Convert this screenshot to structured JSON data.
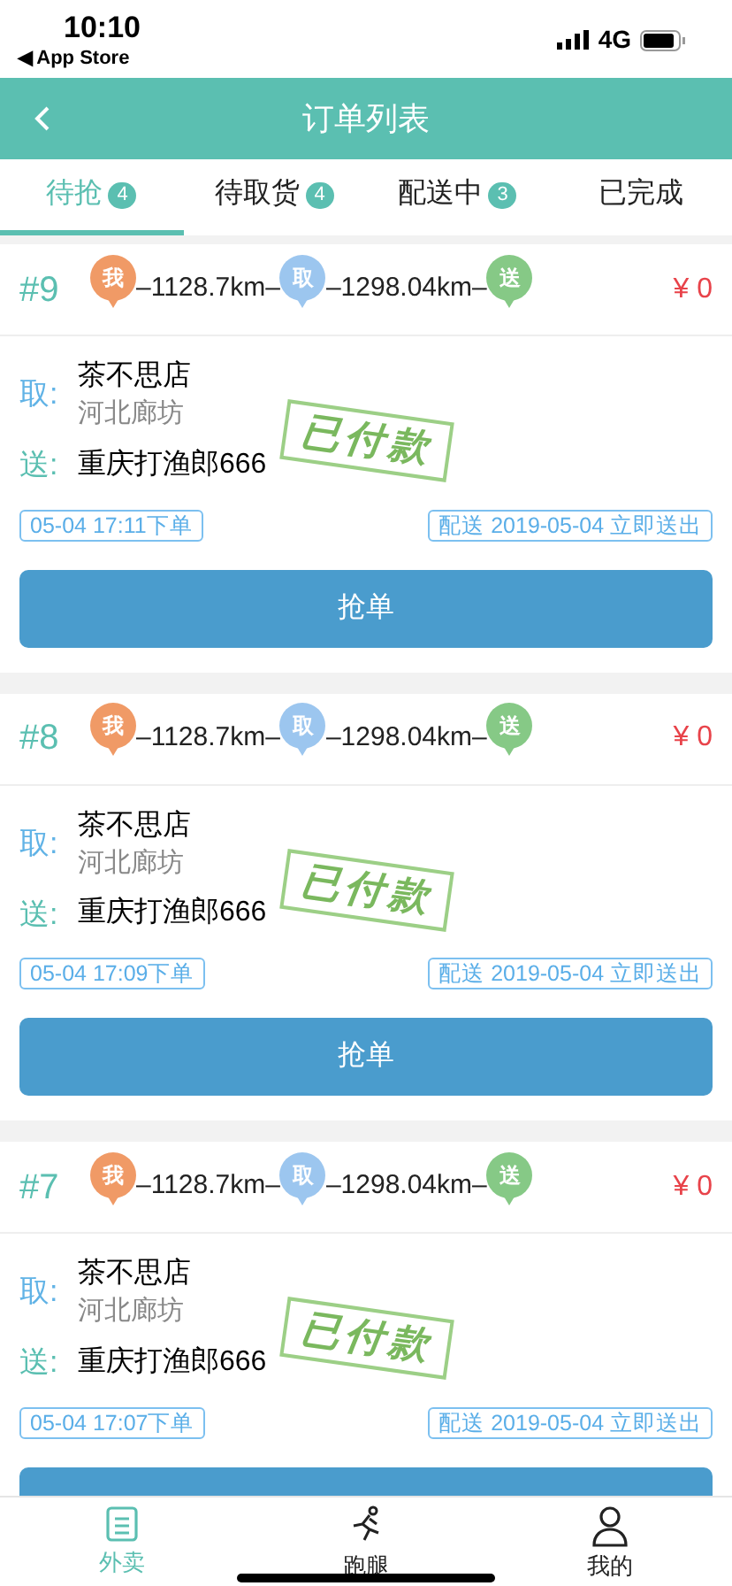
{
  "status_bar": {
    "time": "10:10",
    "back_app": "◀ App Store",
    "network": "4G"
  },
  "header": {
    "title": "订单列表"
  },
  "tabs": [
    {
      "label": "待抢",
      "badge": "4",
      "selected": true
    },
    {
      "label": "待取货",
      "badge": "4",
      "selected": false
    },
    {
      "label": "配送中",
      "badge": "3",
      "selected": false
    },
    {
      "label": "已完成",
      "selected": false
    }
  ],
  "orders": [
    {
      "number": "#9",
      "route": [
        {
          "kind": "pin",
          "label": "我",
          "color": "#f09a66"
        },
        {
          "kind": "distance",
          "text": "–1128.7km–"
        },
        {
          "kind": "pin",
          "label": "取",
          "color": "#9cc6ef"
        },
        {
          "kind": "distance",
          "text": "–1298.04km–"
        },
        {
          "kind": "pin",
          "label": "送",
          "color": "#86c986"
        }
      ],
      "price": "¥ 0",
      "pickup_label": "取:",
      "pickup_name": "茶不思店",
      "pickup_address": "河北廊坊",
      "delivery_label": "送:",
      "delivery_name": "重庆打渔郎666",
      "stamp": "已付款",
      "order_time": "05-04 17:11下单",
      "delivery_time": "配送 2019-05-04 立即送出",
      "action": "抢单"
    },
    {
      "number": "#8",
      "route": [
        {
          "kind": "pin",
          "label": "我",
          "color": "#f09a66"
        },
        {
          "kind": "distance",
          "text": "–1128.7km–"
        },
        {
          "kind": "pin",
          "label": "取",
          "color": "#9cc6ef"
        },
        {
          "kind": "distance",
          "text": "–1298.04km–"
        },
        {
          "kind": "pin",
          "label": "送",
          "color": "#86c986"
        }
      ],
      "price": "¥ 0",
      "pickup_label": "取:",
      "pickup_name": "茶不思店",
      "pickup_address": "河北廊坊",
      "delivery_label": "送:",
      "delivery_name": "重庆打渔郎666",
      "stamp": "已付款",
      "order_time": "05-04 17:09下单",
      "delivery_time": "配送 2019-05-04 立即送出",
      "action": "抢单"
    },
    {
      "number": "#7",
      "route": [
        {
          "kind": "pin",
          "label": "我",
          "color": "#f09a66"
        },
        {
          "kind": "distance",
          "text": "–1128.7km–"
        },
        {
          "kind": "pin",
          "label": "取",
          "color": "#9cc6ef"
        },
        {
          "kind": "distance",
          "text": "–1298.04km–"
        },
        {
          "kind": "pin",
          "label": "送",
          "color": "#86c986"
        }
      ],
      "price": "¥ 0",
      "pickup_label": "取:",
      "pickup_name": "茶不思店",
      "pickup_address": "河北廊坊",
      "delivery_label": "送:",
      "delivery_name": "重庆打渔郎666",
      "stamp": "已付款",
      "order_time": "05-04 17:07下单",
      "delivery_time": "配送 2019-05-04 立即送出"
    }
  ],
  "bottom_nav": [
    {
      "label": "外卖",
      "kind": "list",
      "selected": true
    },
    {
      "label": "跑腿",
      "kind": "runner",
      "selected": false
    },
    {
      "label": "我的",
      "kind": "person",
      "selected": false
    }
  ]
}
